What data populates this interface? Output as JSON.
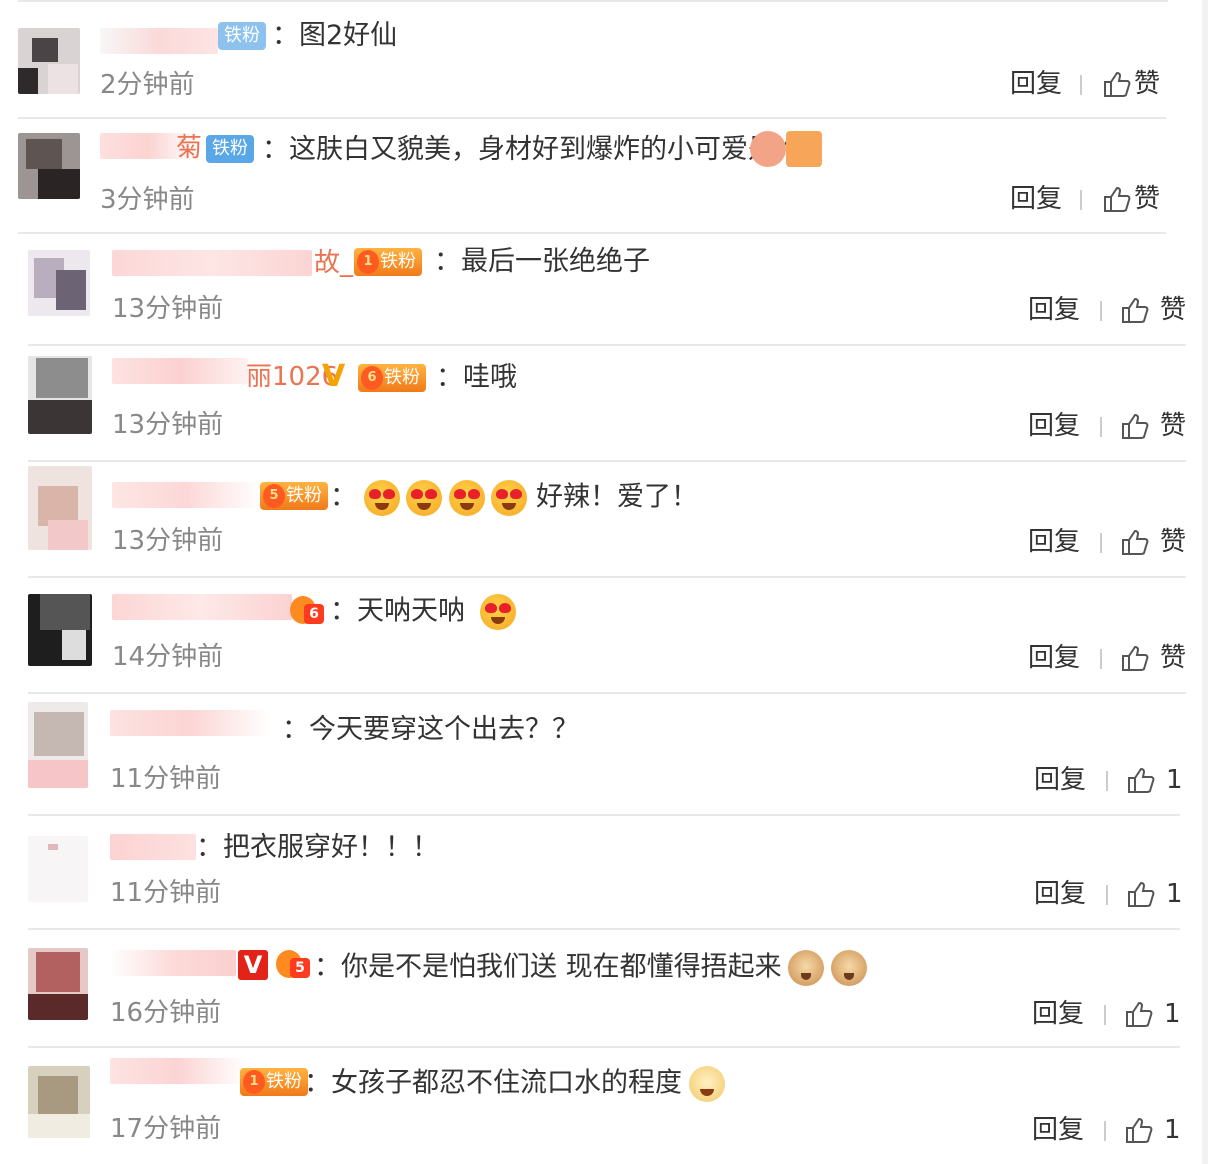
{
  "comments": [
    {
      "tail": "",
      "badge": "铁粉",
      "text": "：图2好仙",
      "time": "2分钟前",
      "reply": "回复",
      "like": "赞"
    },
    {
      "tail": "菊",
      "badge": "铁粉",
      "text": "：这肤白又貌美，身材好到爆炸的小可爱是谁",
      "time": "3分钟前",
      "reply": "回复",
      "like": "赞"
    },
    {
      "tail": "故_",
      "badge": "铁粉",
      "text": "：最后一张绝绝子",
      "time": "13分钟前",
      "reply": "回复",
      "like": "赞"
    },
    {
      "tail": "丽1026",
      "badge": "铁粉",
      "text": "：哇哦",
      "time": "13分钟前",
      "reply": "回复",
      "like": "赞"
    },
    {
      "tail": "",
      "badge": "铁粉",
      "text": "：",
      "text2": "好辣！爱了！",
      "time": "13分钟前",
      "reply": "回复",
      "like": "赞"
    },
    {
      "tail": "",
      "badge": "",
      "text": "：天呐天呐",
      "time": "14分钟前",
      "reply": "回复",
      "like": "赞"
    },
    {
      "tail": "",
      "badge": "",
      "text": "：今天要穿这个出去？？",
      "time": "11分钟前",
      "reply": "回复",
      "like": "1"
    },
    {
      "tail": "",
      "badge": "",
      "text": "：把衣服穿好！！！",
      "time": "11分钟前",
      "reply": "回复",
      "like": "1"
    },
    {
      "tail": "",
      "badge": "",
      "text": "：你是不是怕我们送 现在都懂得捂起来",
      "time": "16分钟前",
      "reply": "回复",
      "like": "1"
    },
    {
      "tail": "",
      "badge": "铁粉",
      "text": "：女孩子都忍不住流口水的程度",
      "time": "17分钟前",
      "reply": "回复",
      "like": "1"
    }
  ],
  "icons": {
    "like": "thumbs-up-icon",
    "vip": "verified-v-icon",
    "crown": "crown-badge-icon",
    "emoji_heart_eyes": "heart-eyes-emoji-icon",
    "emoji_cat": "cat-emoji-icon",
    "emoji_dog": "dog-emoji-icon"
  },
  "colors": {
    "nick_tail": "#eb7350",
    "badge_blue": "#5aa7e8",
    "badge_gold": "#f5a300",
    "divider": "#e8e8e8",
    "time": "#888888"
  }
}
